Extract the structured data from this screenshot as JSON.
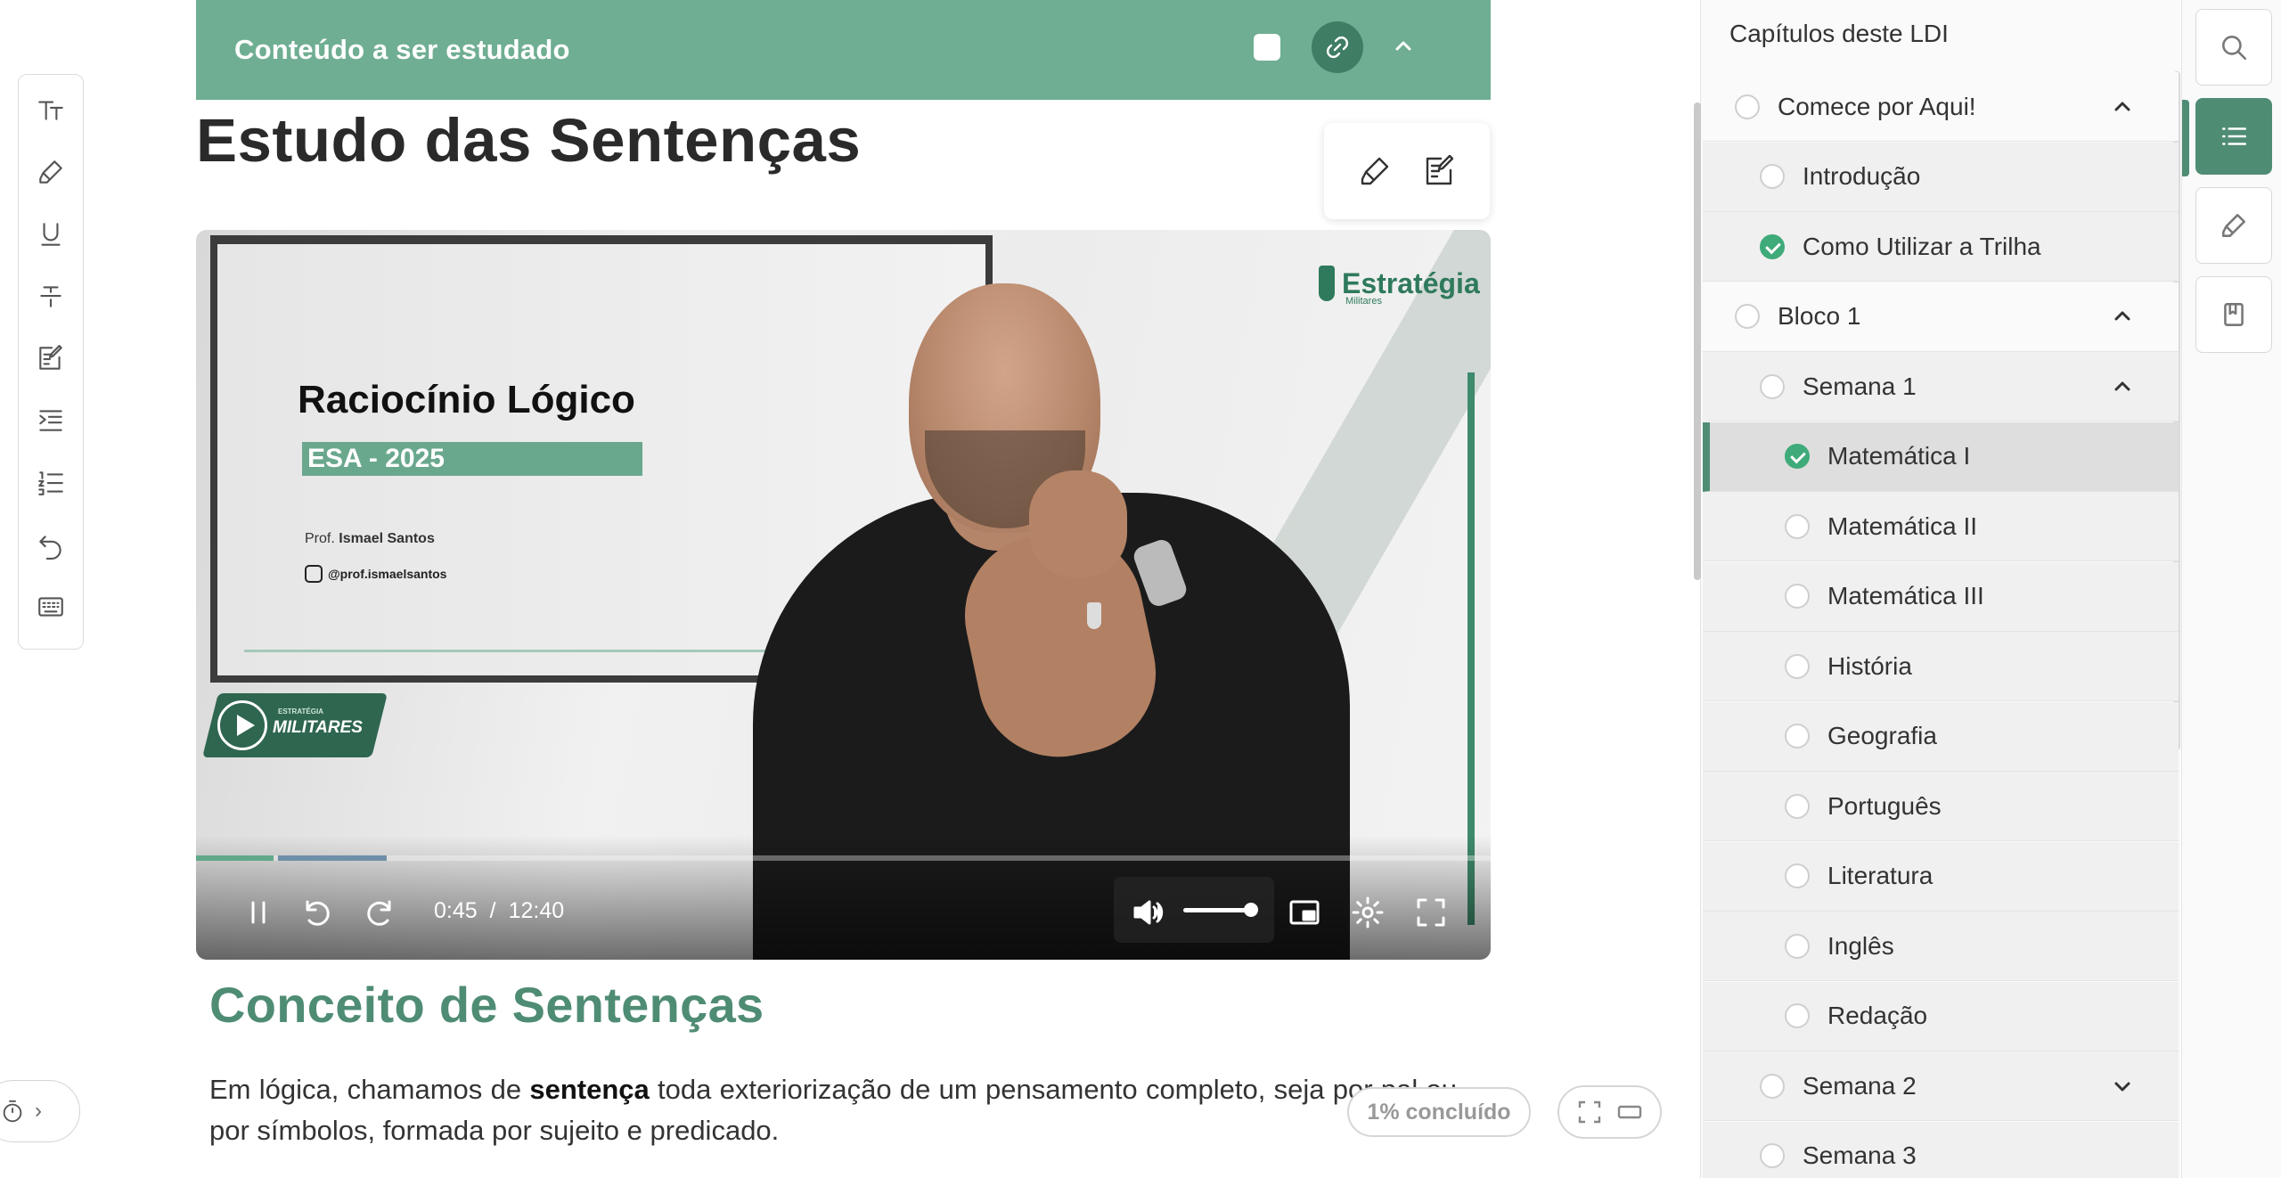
{
  "banner": {
    "title": "Conteúdo a ser estudado"
  },
  "page": {
    "title": "Estudo das Sentenças"
  },
  "video": {
    "board_title": "Raciocínio Lógico",
    "board_subtitle": "ESA - 2025",
    "board_prof_prefix": "Prof.",
    "board_prof_name": "Ismael Santos",
    "board_instagram": "@prof.ismaelsantos",
    "brand_name": "Estratégia",
    "brand_sub": "Militares",
    "badge_small": "ESTRATÉGIA",
    "badge_text": "MILITARES",
    "time_current": "0:45",
    "time_separator": "/",
    "time_total": "12:40",
    "progress_fraction": 0.06,
    "volume_fraction": 0.95
  },
  "section": {
    "title": "Conceito de Sentenças",
    "paragraph_pre": "Em lógica, chamamos de ",
    "paragraph_bold": "sentença",
    "paragraph_post": " toda exteriorização de um pensamento completo, seja por pal ou por símbolos, formada por sujeito e predicado."
  },
  "status": {
    "progress_label": "1% concluído"
  },
  "sidebar": {
    "heading": "Capítulos deste LDI",
    "items": [
      {
        "label": "Comece por Aqui!",
        "level": 1,
        "done": false,
        "caret": "up"
      },
      {
        "label": "Introdução",
        "level": 2,
        "done": false
      },
      {
        "label": "Como Utilizar a Trilha",
        "level": 2,
        "done": true
      },
      {
        "label": "Bloco 1",
        "level": 1,
        "done": false,
        "caret": "up"
      },
      {
        "label": "Semana 1",
        "level": 2,
        "done": false,
        "caret": "up"
      },
      {
        "label": "Matemática I",
        "level": 3,
        "done": true,
        "active": true
      },
      {
        "label": "Matemática II",
        "level": 3,
        "done": false
      },
      {
        "label": "Matemática III",
        "level": 3,
        "done": false
      },
      {
        "label": "História",
        "level": 3,
        "done": false
      },
      {
        "label": "Geografia",
        "level": 3,
        "done": false
      },
      {
        "label": "Português",
        "level": 3,
        "done": false
      },
      {
        "label": "Literatura",
        "level": 3,
        "done": false
      },
      {
        "label": "Inglês",
        "level": 3,
        "done": false
      },
      {
        "label": "Redação",
        "level": 3,
        "done": false
      },
      {
        "label": "Semana 2",
        "level": 2,
        "done": false,
        "caret": "down"
      },
      {
        "label": "Semana 3",
        "level": 2,
        "done": false
      }
    ]
  },
  "colors": {
    "accent": "#6fae92",
    "accent_dark": "#4f8c74",
    "done": "#3faa7a"
  }
}
